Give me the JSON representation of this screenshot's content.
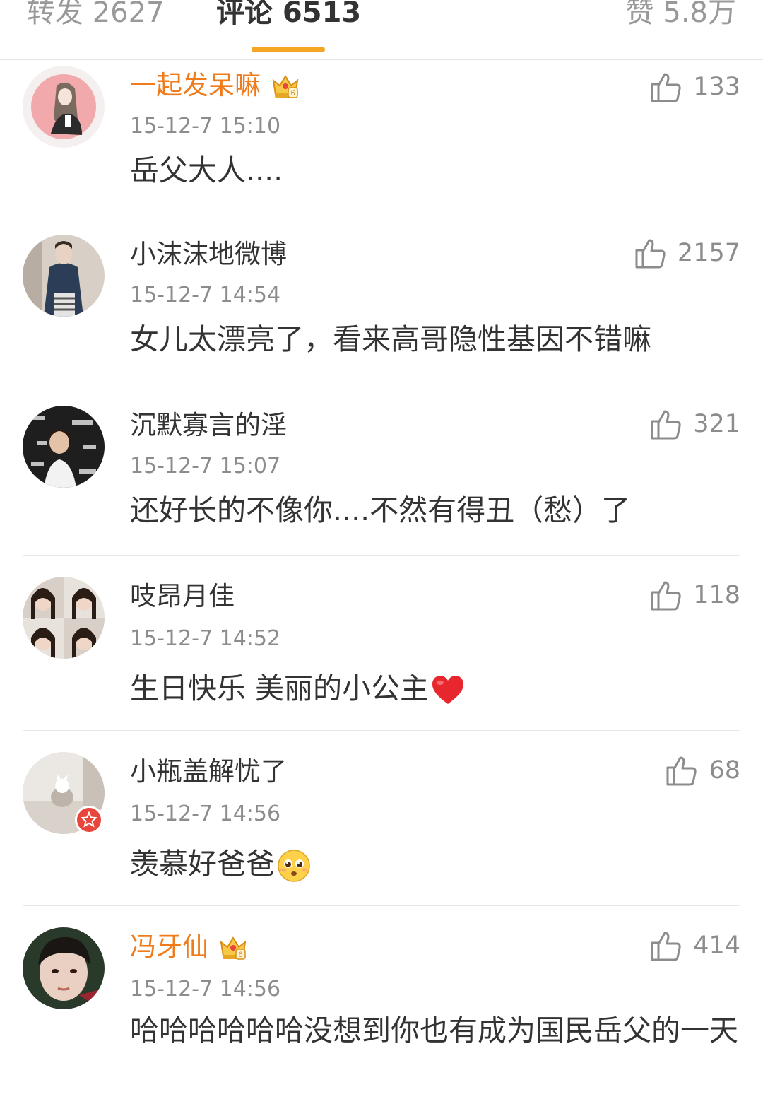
{
  "tabs": {
    "repost": "转发 2627",
    "comment": "评论 6513",
    "like": "赞 5.8万"
  },
  "colors": {
    "accent": "#f5a623",
    "vip_name": "#f07b1b",
    "verified": "#e8453c"
  },
  "comments": [
    {
      "username": "一起发呆嘛",
      "vip": true,
      "time": "15-12-7 15:10",
      "text": "岳父大人....",
      "likes": "133",
      "emoji": null
    },
    {
      "username": "小沫沫地微博",
      "vip": false,
      "time": "15-12-7 14:54",
      "text": "女儿太漂亮了，看来高哥隐性基因不错嘛",
      "likes": "2157",
      "emoji": null
    },
    {
      "username": "沉默寡言的淫",
      "vip": false,
      "time": "15-12-7 15:07",
      "text": "还好长的不像你....不然有得丑（愁）了",
      "likes": "321",
      "emoji": null
    },
    {
      "username": "吱昂月佳",
      "vip": false,
      "time": "15-12-7 14:52",
      "text": "生日快乐 美丽的小公主",
      "likes": "118",
      "emoji": "heart-emoji"
    },
    {
      "username": "小瓶盖解忧了",
      "vip": false,
      "verified": true,
      "time": "15-12-7 14:56",
      "text": "羡慕好爸爸",
      "likes": "68",
      "emoji": "pleading-face-emoji"
    },
    {
      "username": "冯牙仙",
      "vip": true,
      "time": "15-12-7 14:56",
      "text": "哈哈哈哈哈哈没想到你也有成为国民岳父的一天",
      "likes": "414",
      "emoji": null
    }
  ]
}
